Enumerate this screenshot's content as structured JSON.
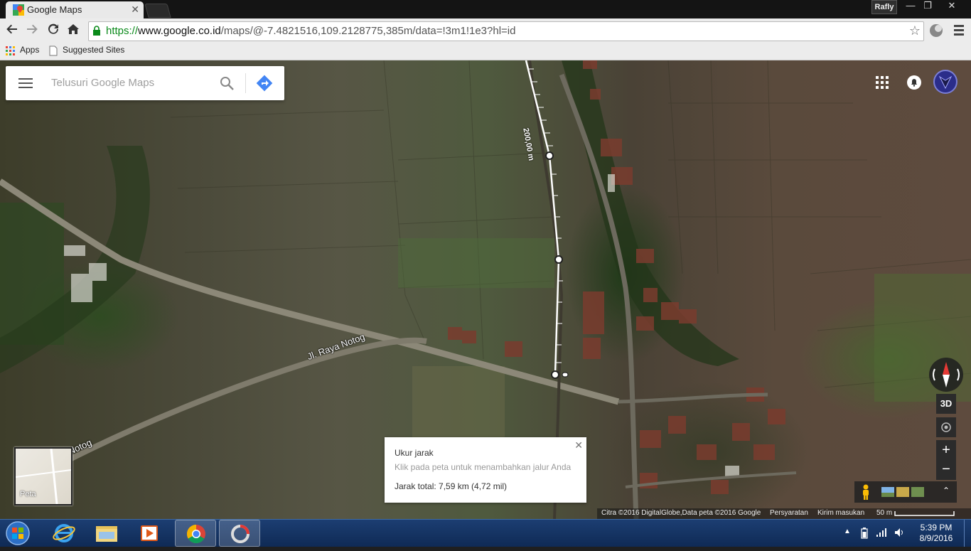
{
  "browser": {
    "tab_title": "Google Maps",
    "profile_name": "Rafly",
    "url_scheme": "https://",
    "url_host": "www.google.co.id",
    "url_path": "/maps/@-7.4821516,109.2128775,385m/data=!3m1!1e3?hl=id"
  },
  "bookmarks": {
    "apps": "Apps",
    "suggested": "Suggested Sites"
  },
  "maps": {
    "search_placeholder": "Telusuri Google Maps",
    "road_label": "Jl. Raya Notog",
    "road_label_2": "Notog",
    "distance_label": "200,00 m",
    "basemap_toggle": "Peta",
    "btn_3d": "3D",
    "zoom_in": "+",
    "zoom_out": "−",
    "measure": {
      "title": "Ukur jarak",
      "hint": "Klik pada peta untuk menambahkan jalur Anda",
      "total": "Jarak total: 7,59 km (4,72 mil)"
    },
    "attribution": {
      "imagery": "Citra ©2016 DigitalGlobe,Data peta ©2016 Google",
      "terms": "Persyaratan",
      "feedback": "Kirim masukan",
      "scale": "50 m"
    }
  },
  "taskbar": {
    "time": "5:39 PM",
    "date": "8/9/2016"
  },
  "colors": {
    "accent_blue": "#4285f4",
    "measure_line": "#ffffff",
    "taskbar": "#163766"
  }
}
